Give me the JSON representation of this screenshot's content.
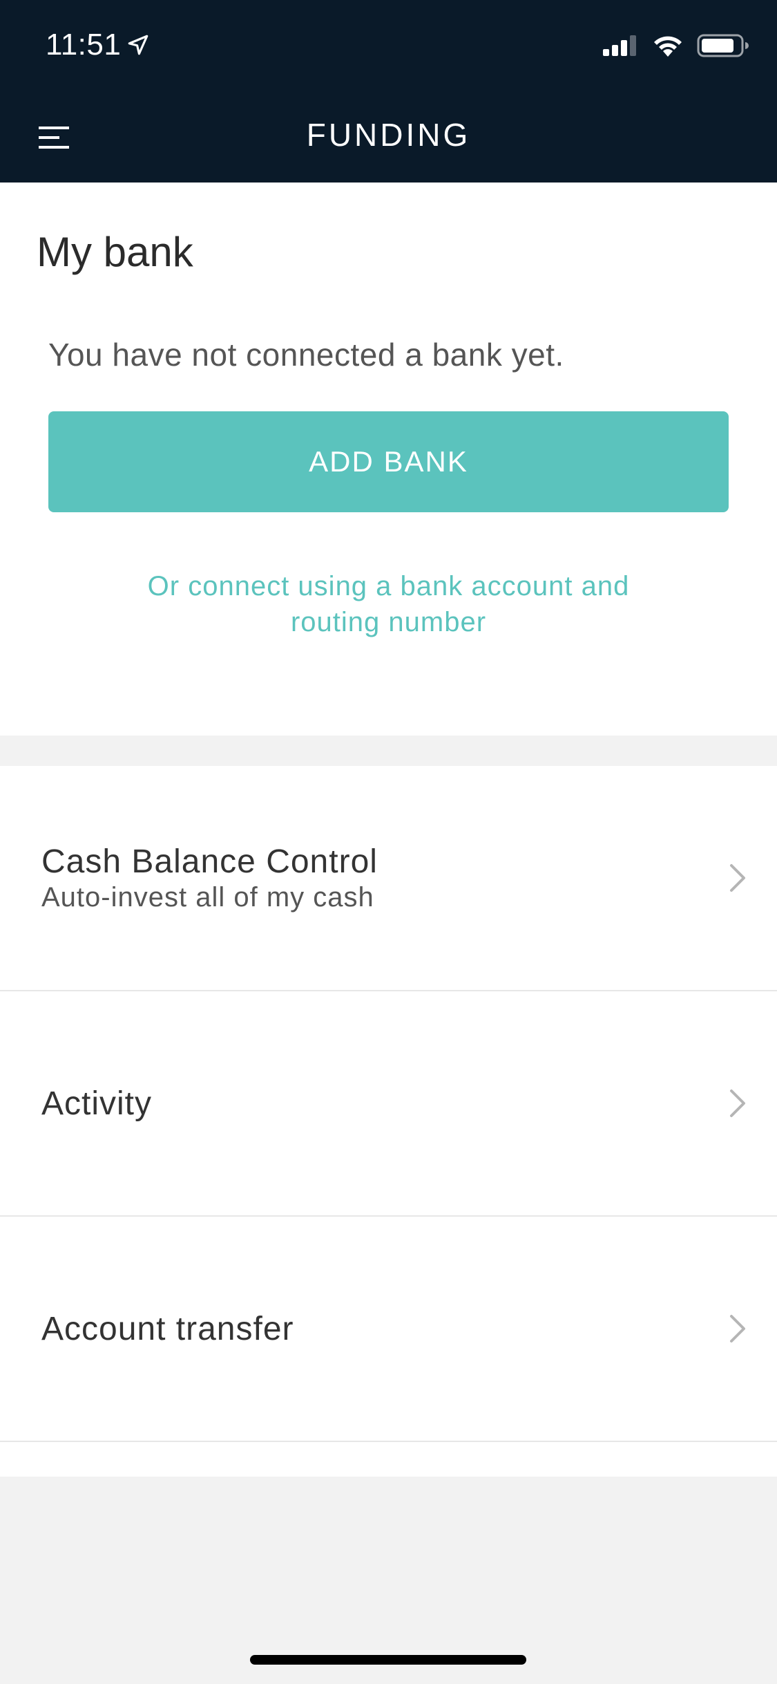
{
  "status_bar": {
    "time": "11:51",
    "icons": [
      "location-arrow-icon",
      "signal-icon",
      "wifi-icon",
      "battery-icon"
    ]
  },
  "nav": {
    "title": "FUNDING",
    "menu_icon": "hamburger-menu-icon"
  },
  "bank": {
    "heading": "My bank",
    "message": "You have not connected a bank yet.",
    "add_button_label": "ADD BANK",
    "connect_link_line1": "Or connect using a bank account and",
    "connect_link_line2": "routing number"
  },
  "list": {
    "items": [
      {
        "title": "Cash Balance Control",
        "subtitle": "Auto-invest all of my cash"
      },
      {
        "title": "Activity"
      },
      {
        "title": "Account transfer"
      }
    ]
  },
  "colors": {
    "header_bg": "#0a1a29",
    "accent": "#5bc3bd",
    "page_bg": "#f2f2f2"
  }
}
